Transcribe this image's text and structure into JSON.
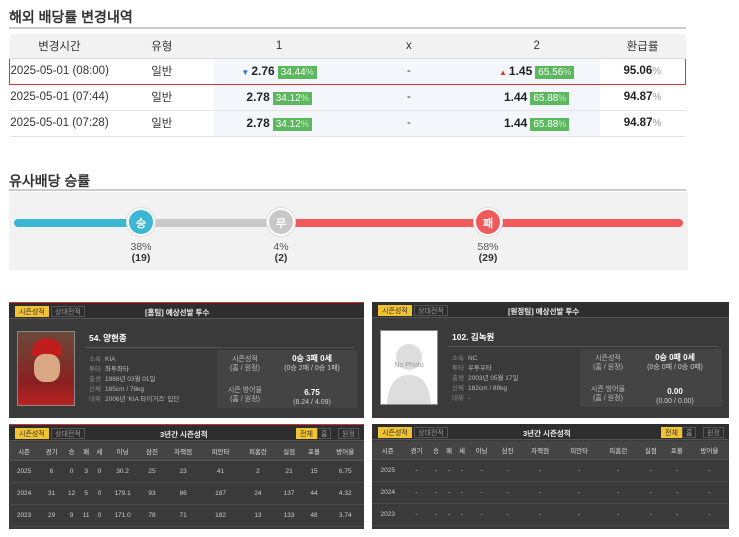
{
  "odds_history": {
    "title": "해외 배당률 변경내역",
    "headers": [
      "변경시간",
      "유형",
      "1",
      "x",
      "2",
      "환급률"
    ],
    "rows": [
      {
        "time": "2025-05-01 (08:00)",
        "type": "일반",
        "home_odds": "2.76",
        "home_pct": "34.44",
        "draw": "-",
        "away_odds": "1.45",
        "away_pct": "65.56",
        "refund": "95.06",
        "home_arrow": "▼",
        "away_arrow": "▲"
      },
      {
        "time": "2025-05-01 (07:44)",
        "type": "일반",
        "home_odds": "2.78",
        "home_pct": "34.12",
        "draw": "-",
        "away_odds": "1.44",
        "away_pct": "65.88",
        "refund": "94.87"
      },
      {
        "time": "2025-05-01 (07:28)",
        "type": "일반",
        "home_odds": "2.78",
        "home_pct": "34.12",
        "draw": "-",
        "away_odds": "1.44",
        "away_pct": "65.88",
        "refund": "94.87"
      }
    ],
    "pct_sign": "%"
  },
  "similar": {
    "title": "유사배당 승률",
    "win": {
      "label": "승",
      "pct": "38%",
      "count": "(19)",
      "color": "#3bb6d3"
    },
    "draw": {
      "label": "무",
      "pct": "4%",
      "count": "(2)",
      "color": "#c8c8c8"
    },
    "lose": {
      "label": "패",
      "pct": "58%",
      "count": "(29)",
      "color": "#f05a5a"
    }
  },
  "pitchers": [
    {
      "tab_on": "시즌성적",
      "tab_off": "상대전적",
      "heading": "[홈팀] 예상선발 투수",
      "name": "54. 양현종",
      "info": [
        {
          "k": "소속",
          "v": "KIA"
        },
        {
          "k": "투타",
          "v": "좌투좌타"
        },
        {
          "k": "출생",
          "v": "1988년 03월 01일"
        },
        {
          "k": "신체",
          "v": "185cm / 78kg"
        },
        {
          "k": "데뷔",
          "v": "2006년 'KIA 타이거즈' 입단"
        }
      ],
      "season_label": "시즌성적",
      "season_sub": "(홈 / 원정)",
      "season_value": "0승 3패 0세",
      "season_detail": "(0승 2패 / 0승 1패)",
      "era_label": "시즌 방어율",
      "era_sub": "(홈 / 원정)",
      "era_value": "6.75",
      "era_detail": "(8.24 / 4.09)",
      "table_title": "3년간 시즌성적",
      "filters": [
        "전체",
        "홈",
        "원정"
      ],
      "columns": [
        "시즌",
        "경기",
        "승",
        "패",
        "세",
        "이닝",
        "삼진",
        "자책점",
        "피안타",
        "피홈런",
        "실점",
        "포볼",
        "방어율"
      ],
      "rows": [
        [
          "2025",
          "6",
          "0",
          "3",
          "0",
          "30.2",
          "25",
          "23",
          "41",
          "2",
          "21",
          "15",
          "6.75"
        ],
        [
          "2024",
          "31",
          "12",
          "5",
          "0",
          "179.1",
          "93",
          "86",
          "187",
          "24",
          "137",
          "44",
          "4.32"
        ],
        [
          "2023",
          "29",
          "9",
          "11",
          "0",
          "171.0",
          "78",
          "71",
          "182",
          "13",
          "133",
          "48",
          "3.74"
        ]
      ]
    },
    {
      "tab_on": "시즌성적",
      "tab_off": "상대전적",
      "heading": "[원정팀] 예상선발 투수",
      "name": "102. 김녹원",
      "photo_text": "No Photo",
      "info": [
        {
          "k": "소속",
          "v": "NC"
        },
        {
          "k": "투타",
          "v": "우투우타"
        },
        {
          "k": "출생",
          "v": "2003년 05월 17일"
        },
        {
          "k": "신체",
          "v": "182cm / 88kg"
        },
        {
          "k": "데뷔",
          "v": "-"
        }
      ],
      "season_label": "시즌성적",
      "season_sub": "(홈 / 원정)",
      "season_value": "0승 0패 0세",
      "season_detail": "(0승 0패 / 0승 0패)",
      "era_label": "시즌 방어율",
      "era_sub": "(홈 / 원정)",
      "era_value": "0.00",
      "era_detail": "(0.00 / 0.00)",
      "table_title": "3년간 시즌성적",
      "filters": [
        "전체",
        "홈",
        "원정"
      ],
      "columns": [
        "시즌",
        "경기",
        "승",
        "패",
        "세",
        "이닝",
        "삼진",
        "자책점",
        "피안타",
        "피홈런",
        "실점",
        "포볼",
        "방어율"
      ],
      "rows": [
        [
          "2025",
          "-",
          "-",
          "-",
          "-",
          "-",
          "-",
          "-",
          "-",
          "-",
          "-",
          "-",
          "-"
        ],
        [
          "2024",
          "-",
          "-",
          "-",
          "-",
          "-",
          "-",
          "-",
          "-",
          "-",
          "-",
          "-",
          "-"
        ],
        [
          "2023",
          "-",
          "-",
          "-",
          "-",
          "-",
          "-",
          "-",
          "-",
          "-",
          "-",
          "-",
          "-"
        ]
      ]
    }
  ]
}
